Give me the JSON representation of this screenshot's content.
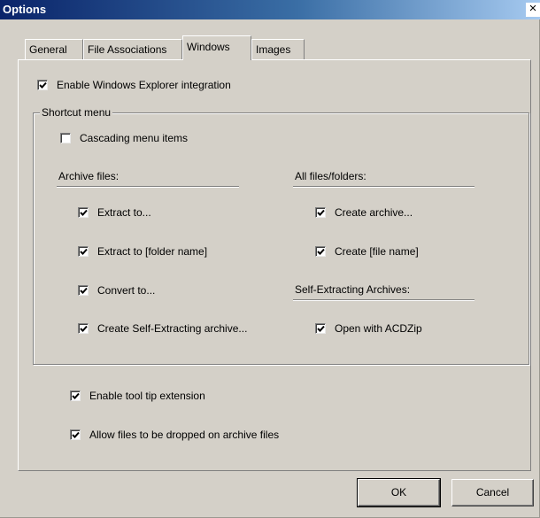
{
  "window": {
    "title": "Options",
    "close_glyph": "×"
  },
  "tabs": [
    {
      "label": "General",
      "active": false
    },
    {
      "label": "File Associations",
      "active": false
    },
    {
      "label": "Windows",
      "active": true
    },
    {
      "label": "Images",
      "active": false
    }
  ],
  "panel": {
    "enable_explorer": {
      "label": "Enable Windows Explorer integration",
      "checked": true
    },
    "shortcut_group": {
      "title": "Shortcut menu",
      "cascading": {
        "label": "Cascading menu items",
        "checked": false
      },
      "archive_files": {
        "heading": "Archive files:",
        "items": [
          {
            "label": "Extract to...",
            "checked": true
          },
          {
            "label": "Extract to [folder name]",
            "checked": true
          },
          {
            "label": "Convert to...",
            "checked": true
          },
          {
            "label": "Create Self-Extracting archive...",
            "checked": true
          }
        ]
      },
      "all_files": {
        "heading": "All files/folders:",
        "items": [
          {
            "label": "Create archive...",
            "checked": true
          },
          {
            "label": "Create [file name]",
            "checked": true
          }
        ]
      },
      "self_extracting": {
        "heading": "Self-Extracting Archives:",
        "items": [
          {
            "label": "Open with ACDZip",
            "checked": true
          }
        ]
      }
    },
    "tooltip_ext": {
      "label": "Enable tool tip extension",
      "checked": true
    },
    "allow_drop": {
      "label": "Allow files to be dropped on archive files",
      "checked": true
    }
  },
  "buttons": {
    "ok": "OK",
    "cancel": "Cancel"
  },
  "colors": {
    "face": "#d4d0c8",
    "title_start": "#0a246a",
    "title_end": "#a6caf0"
  }
}
